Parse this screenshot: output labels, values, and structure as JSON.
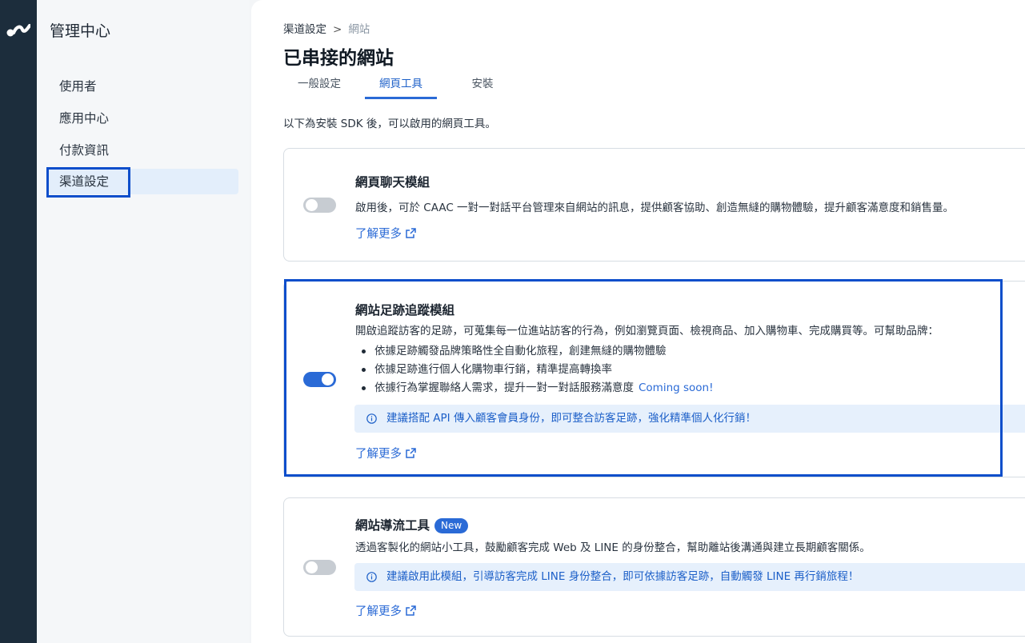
{
  "app": {
    "section_title": "管理中心"
  },
  "sidebar": {
    "items": [
      {
        "label": "使用者"
      },
      {
        "label": "應用中心"
      },
      {
        "label": "付款資訊"
      },
      {
        "label": "渠道設定"
      }
    ]
  },
  "breadcrumb": {
    "parent": "渠道設定",
    "separator": ">",
    "current": "網站"
  },
  "page": {
    "title": "已串接的網站"
  },
  "tabs": [
    {
      "label": "一般設定"
    },
    {
      "label": "網頁工具"
    },
    {
      "label": "安裝"
    }
  ],
  "intro": "以下為安裝 SDK 後，可以啟用的網頁工具。",
  "modules": [
    {
      "title": "網頁聊天模組",
      "enabled": false,
      "description": "啟用後，可於 CAAC 一對一對話平台管理來自網站的訊息，提供顧客協助、創造無縫的購物體驗，提升顧客滿意度和銷售量。",
      "learn_more": "了解更多"
    },
    {
      "title": "網站足跡追蹤模組",
      "enabled": true,
      "description": "開啟追蹤訪客的足跡，可蒐集每一位進站訪客的行為，例如瀏覽頁面、檢視商品、加入購物車、完成購買等。可幫助品牌：",
      "bullets": [
        "依據足跡觸發品牌策略性全自動化旅程，創建無縫的購物體驗",
        "依據足跡進行個人化購物車行銷，精準提高轉換率",
        "依據行為掌握聯絡人需求，提升一對一對話服務滿意度"
      ],
      "coming_soon": "Coming soon!",
      "info": "建議搭配 API 傳入顧客會員身份，即可整合訪客足跡，強化精準個人化行銷！",
      "learn_more": "了解更多"
    },
    {
      "title": "網站導流工具",
      "badge": "New",
      "enabled": false,
      "description": "透過客製化的網站小工具，鼓勵顧客完成 Web 及 LINE 的身份整合，幫助離站後溝通與建立長期顧客關係。",
      "info": "建議啟用此模組，引導訪客完成 LINE 身份整合，即可依據訪客足跡，自動觸發 LINE 再行銷旅程！",
      "learn_more": "了解更多"
    }
  ],
  "colors": {
    "accent": "#2a6ad6",
    "rail": "#1c2d3c",
    "highlight_border": "#0d4ecb",
    "info_bg": "#e6f0fc"
  }
}
